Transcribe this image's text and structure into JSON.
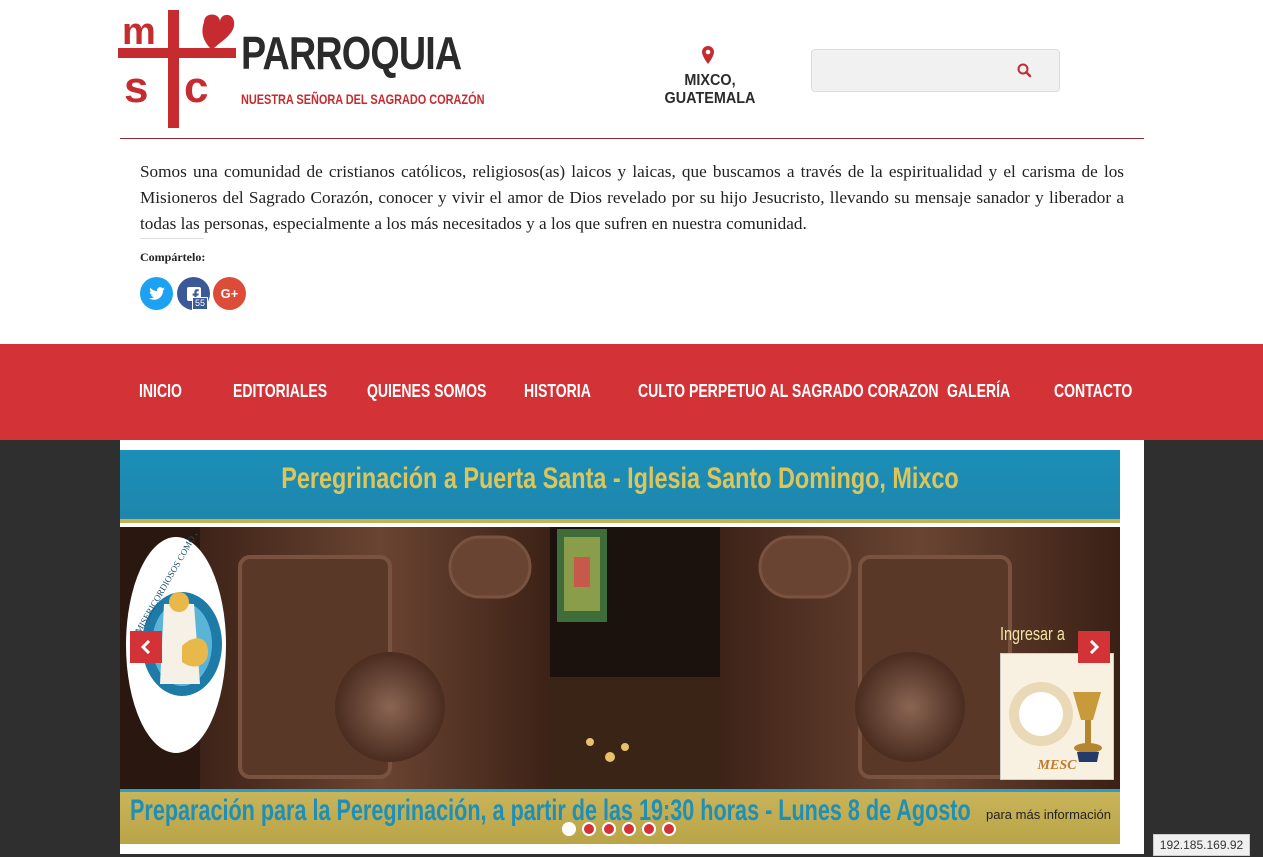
{
  "header": {
    "logo_letters": "msc",
    "brand_title": "PARROQUIA",
    "brand_subtitle": "NUESTRA SEÑORA DEL SAGRADO CORAZÓN",
    "location": "MIXCO, GUATEMALA",
    "search": {
      "placeholder": "",
      "value": ""
    },
    "icons": {
      "location": "map-pin-icon",
      "search": "magnifier-icon"
    }
  },
  "intro": {
    "text": "Somos una comunidad de cristianos católicos, religiosos(as) laicos y laicas, que buscamos a través de la espiritualidad y el carisma de los Misioneros del Sagrado Corazón, conocer y vivir el amor de Dios revelado por su hijo Jesucristo, llevando su mensaje sanador y liberador a todas las personas, especialmente a los más necesitados y a los que sufren en nuestra comunidad.",
    "share_label": "Compártelo:",
    "share": [
      {
        "network": "twitter",
        "icon": "twitter-icon",
        "color": "#1da1f2"
      },
      {
        "network": "facebook",
        "icon": "facebook-icon",
        "color": "#3b5998",
        "count": "55"
      },
      {
        "network": "google-plus",
        "icon": "google-plus-icon",
        "color": "#dd4b39",
        "glyph": "G+"
      }
    ]
  },
  "nav": {
    "items": [
      "INICIO",
      "EDITORIALES",
      "QUIENES SOMOS",
      "HISTORIA",
      "CULTO PERPETUO AL SAGRADO CORAZON",
      "GALERÍA",
      "CONTACTO"
    ]
  },
  "slider": {
    "title": "Peregrinación a Puerta Santa - Iglesia Santo Domingo, Mixco",
    "caption": "Preparación para la Peregrinación, a partir de las 19:30 horas - Lunes 8 de Agosto",
    "more_info": "para más información",
    "side_label": "Ingresar a",
    "badge_text": "MESC",
    "seal_text": "MISERICORDIOSOS COMO EL PADRE",
    "dots": 6,
    "active_dot": 1
  },
  "colors": {
    "accent": "#d33237",
    "dark": "#2f2f2f",
    "slide_blue": "#1f8fb6",
    "slide_gold": "#c9b45a"
  },
  "ip_label": "192.185.169.92"
}
